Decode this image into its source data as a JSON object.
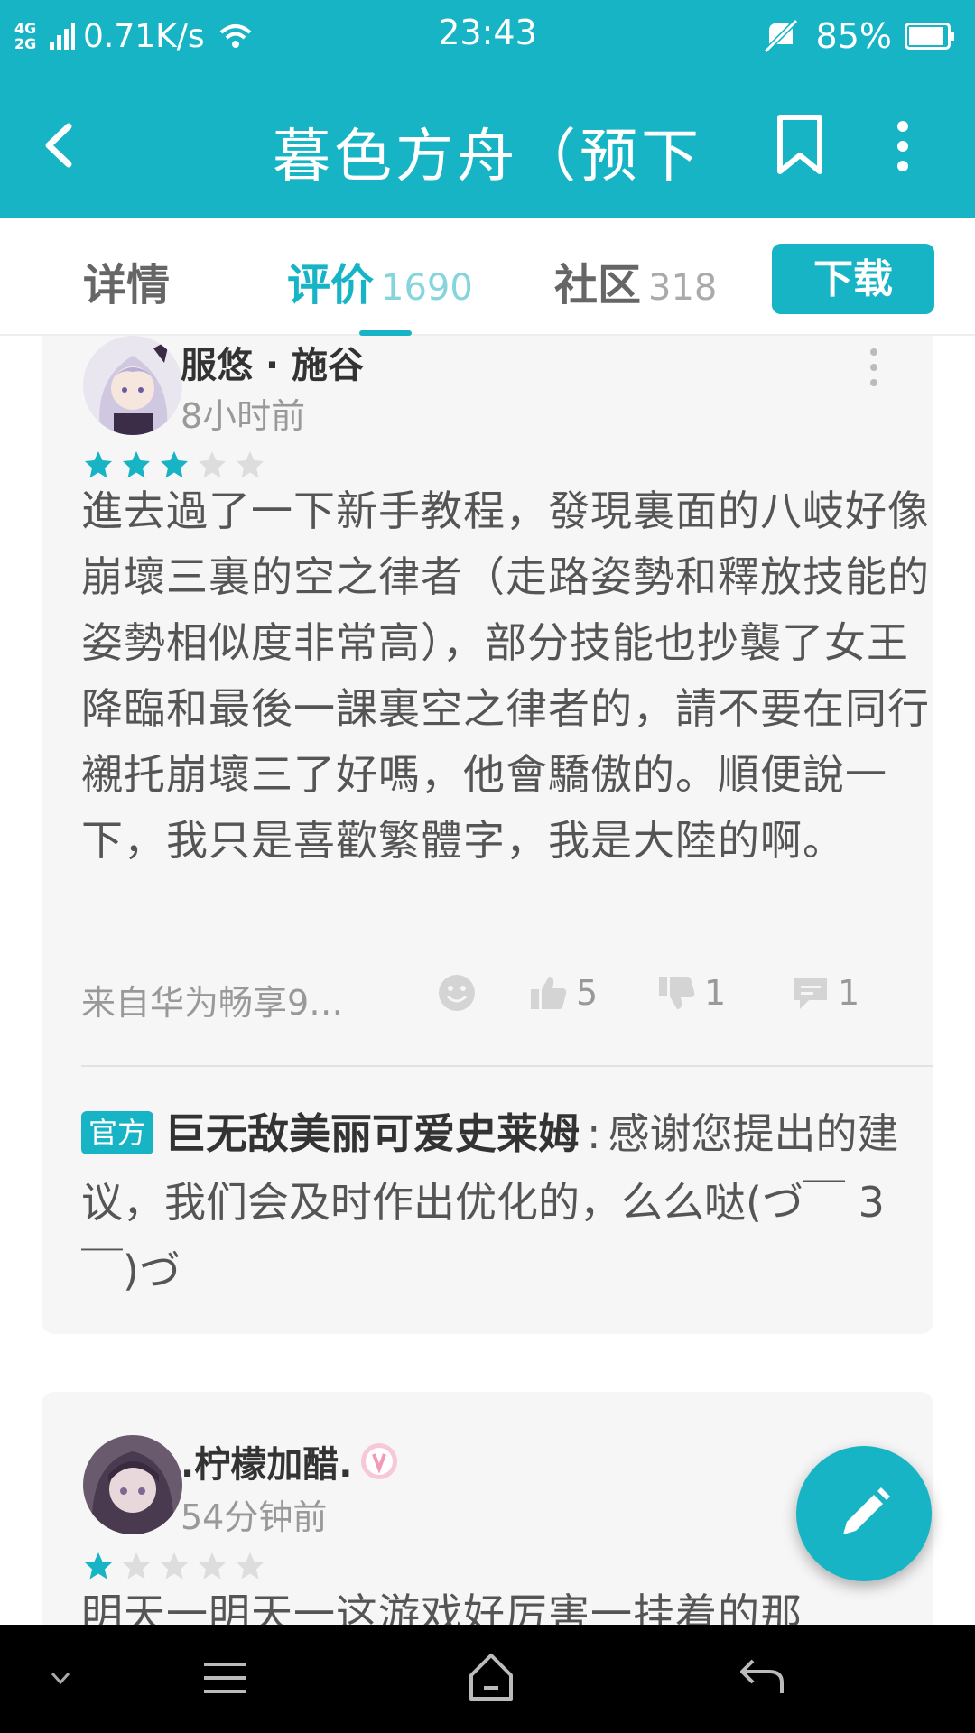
{
  "status_bar": {
    "network_top": "4G",
    "network_bottom": "2G",
    "speed": "0.71K/s",
    "time": "23:43",
    "battery_percent": "85%"
  },
  "app_bar": {
    "title": "暮色方舟（预下"
  },
  "tabs": [
    {
      "label": "详情",
      "count": ""
    },
    {
      "label": "评价",
      "count": "1690"
    },
    {
      "label": "社区",
      "count": "318"
    }
  ],
  "download_label": "下载",
  "reviews": [
    {
      "username": "服悠 · 施谷",
      "time": "8小时前",
      "rating": 3,
      "text": "進去過了一下新手教程，發現裏面的八岐好像崩壞三裏的空之律者（走路姿勢和釋放技能的姿勢相似度非常高），部分技能也抄襲了女王降臨和最後一課裏空之律者的，請不要在同行襯托崩壞三了好嗎，他會驕傲的。順便說一下，我只是喜歡繁體字，我是大陸的啊。",
      "device": "来自华为畅享9…",
      "likes": "5",
      "dislikes": "1",
      "comments": "1",
      "reply": {
        "badge": "官方",
        "name": "巨无敌美丽可爱史莱姆",
        "separator": ":",
        "text": "感谢您提出的建议，我们会及时作出优化的，么么哒(づ￣ 3￣)づ"
      }
    },
    {
      "username": ".柠檬加醋.",
      "time": "54分钟前",
      "rating": 1,
      "text": "明天一明天一这游戏好厉害一挂着的那"
    }
  ],
  "colors": {
    "accent": "#16b4c4",
    "star_filled": "#16b4c4",
    "star_empty": "#dddddd"
  }
}
